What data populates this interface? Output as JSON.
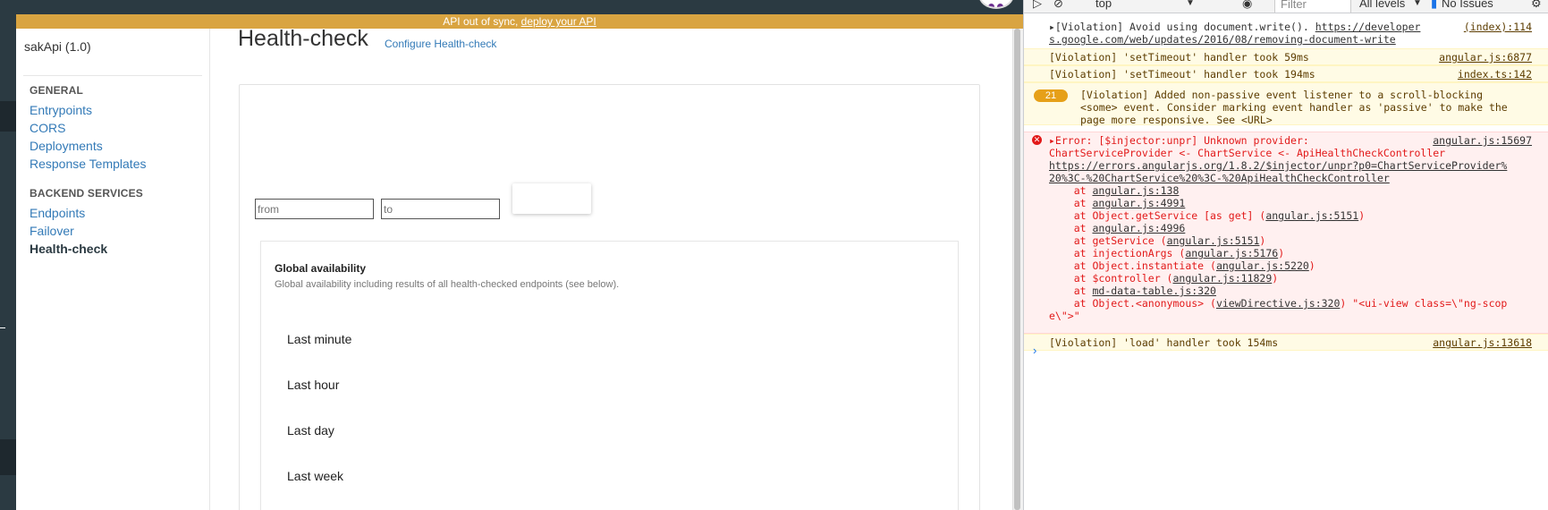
{
  "banner": {
    "text": "API out of sync, ",
    "link": "deploy your API"
  },
  "sidebar": {
    "api_name": "sakApi (1.0)",
    "general_title": "GENERAL",
    "general_items": [
      "Entrypoints",
      "CORS",
      "Deployments",
      "Response Templates"
    ],
    "backend_title": "BACKEND SERVICES",
    "backend_items": [
      "Endpoints",
      "Failover",
      "Health-check"
    ]
  },
  "main": {
    "title": "Health-check",
    "config_link": "Configure Health-check",
    "from_placeholder": "from",
    "to_placeholder": "to",
    "availability": {
      "title": "Global availability",
      "description": "Global availability including results of all health-checked endpoints (see below).",
      "periods": [
        "Last minute",
        "Last hour",
        "Last day",
        "Last week"
      ]
    }
  },
  "devtools": {
    "context": "top",
    "filter_placeholder": "Filter",
    "levels": "All levels",
    "issues": "No Issues",
    "messages": {
      "m1_line1": "▸[Violation] Avoid using document.write(). ",
      "m1_link1": "https://developer",
      "m1_src": "(index):114",
      "m1_line2": "s.google.com/web/updates/2016/08/removing-document-write",
      "m2": "[Violation] 'setTimeout' handler took 59ms",
      "m2_src": "angular.js:6877",
      "m3": "[Violation] 'setTimeout' handler took 194ms",
      "m3_src": "index.ts:142",
      "badge": "21",
      "m4_l1": "[Violation] Added non-passive event listener to a scroll-blocking",
      "m4_l2": "<some> event. Consider marking event handler as 'passive' to make the",
      "m4_l3": "page more responsive. See <URL>",
      "err_l1": "▸Error: [$injector:unpr] Unknown provider:",
      "err_src": "angular.js:15697",
      "err_l2": "ChartServiceProvider <- ChartService <- ApiHealthCheckController",
      "err_l3": "https://errors.angularjs.org/1.8.2/$injector/unpr?p0=ChartServiceProvider%",
      "err_l4": "20%3C-%20ChartService%20%3C-%20ApiHealthCheckController",
      "stack": [
        [
          "    at ",
          "angular.js:138",
          ""
        ],
        [
          "    at ",
          "angular.js:4991",
          ""
        ],
        [
          "    at Object.getService [as get] (",
          "angular.js:5151",
          ")"
        ],
        [
          "    at ",
          "angular.js:4996",
          ""
        ],
        [
          "    at getService (",
          "angular.js:5151",
          ")"
        ],
        [
          "    at injectionArgs (",
          "angular.js:5176",
          ")"
        ],
        [
          "    at Object.instantiate (",
          "angular.js:5220",
          ")"
        ],
        [
          "    at $controller (",
          "angular.js:11829",
          ")"
        ],
        [
          "    at ",
          "md-data-table.js:320",
          ""
        ],
        [
          "    at Object.<anonymous> (",
          "viewDirective.js:320",
          ") \"<ui-view class=\\\"ng-scop"
        ]
      ],
      "err_last": "e\\\">\"",
      "m5": "[Violation] 'load' handler took 154ms",
      "m5_src": "angular.js:13618"
    }
  }
}
